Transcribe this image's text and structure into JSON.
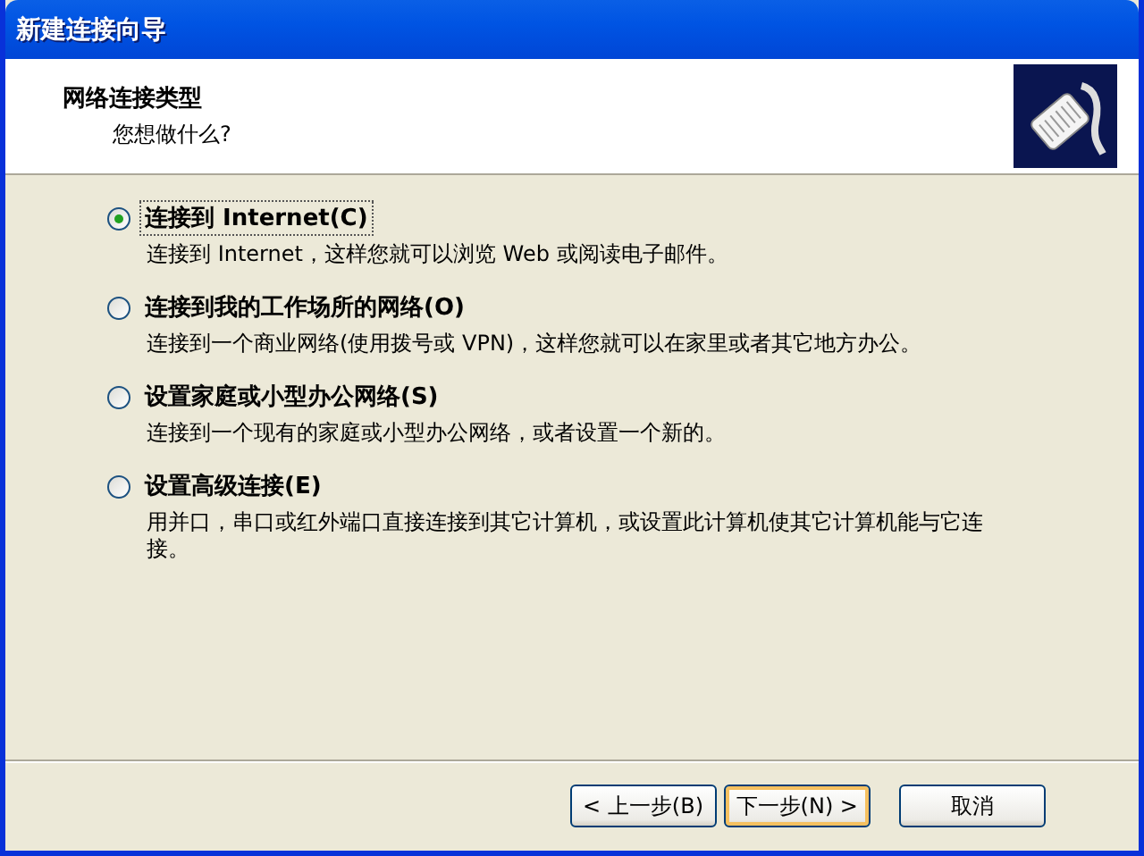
{
  "window": {
    "title": "新建连接向导"
  },
  "header": {
    "title": "网络连接类型",
    "subtitle": "您想做什么?"
  },
  "options": [
    {
      "label": "连接到 Internet(C)",
      "description": "连接到 Internet，这样您就可以浏览 Web 或阅读电子邮件。",
      "selected": true
    },
    {
      "label": "连接到我的工作场所的网络(O)",
      "description": "连接到一个商业网络(使用拨号或 VPN)，这样您就可以在家里或者其它地方办公。",
      "selected": false
    },
    {
      "label": "设置家庭或小型办公网络(S)",
      "description": "连接到一个现有的家庭或小型办公网络，或者设置一个新的。",
      "selected": false
    },
    {
      "label": "设置高级连接(E)",
      "description": "用并口，串口或红外端口直接连接到其它计算机，或设置此计算机使其它计算机能与它连接。",
      "selected": false
    }
  ],
  "buttons": [
    {
      "label": "< 上一步(B)",
      "default": false
    },
    {
      "label": "下一步(N) >",
      "default": true
    },
    {
      "label": "取消",
      "default": false
    }
  ]
}
